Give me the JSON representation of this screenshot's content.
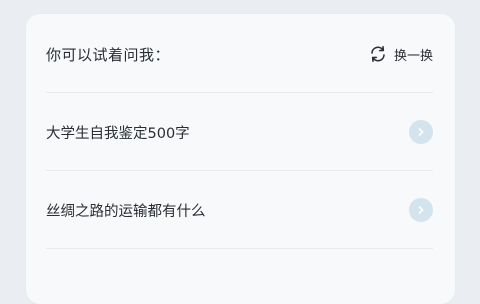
{
  "prompt_card": {
    "title": "你可以试着问我：",
    "refresh_label": "换一换",
    "suggestions": [
      {
        "text": "大学生自我鉴定500字"
      },
      {
        "text": "丝绸之路的运输都有什么"
      }
    ]
  },
  "colors": {
    "page_background": "#eaeef3",
    "card_background": "#f7f9fb",
    "text": "#2a2d33",
    "arrow_circle": "#d3e4ef"
  },
  "icons": {
    "refresh": "refresh-icon",
    "arrow": "chevron-right-icon"
  }
}
